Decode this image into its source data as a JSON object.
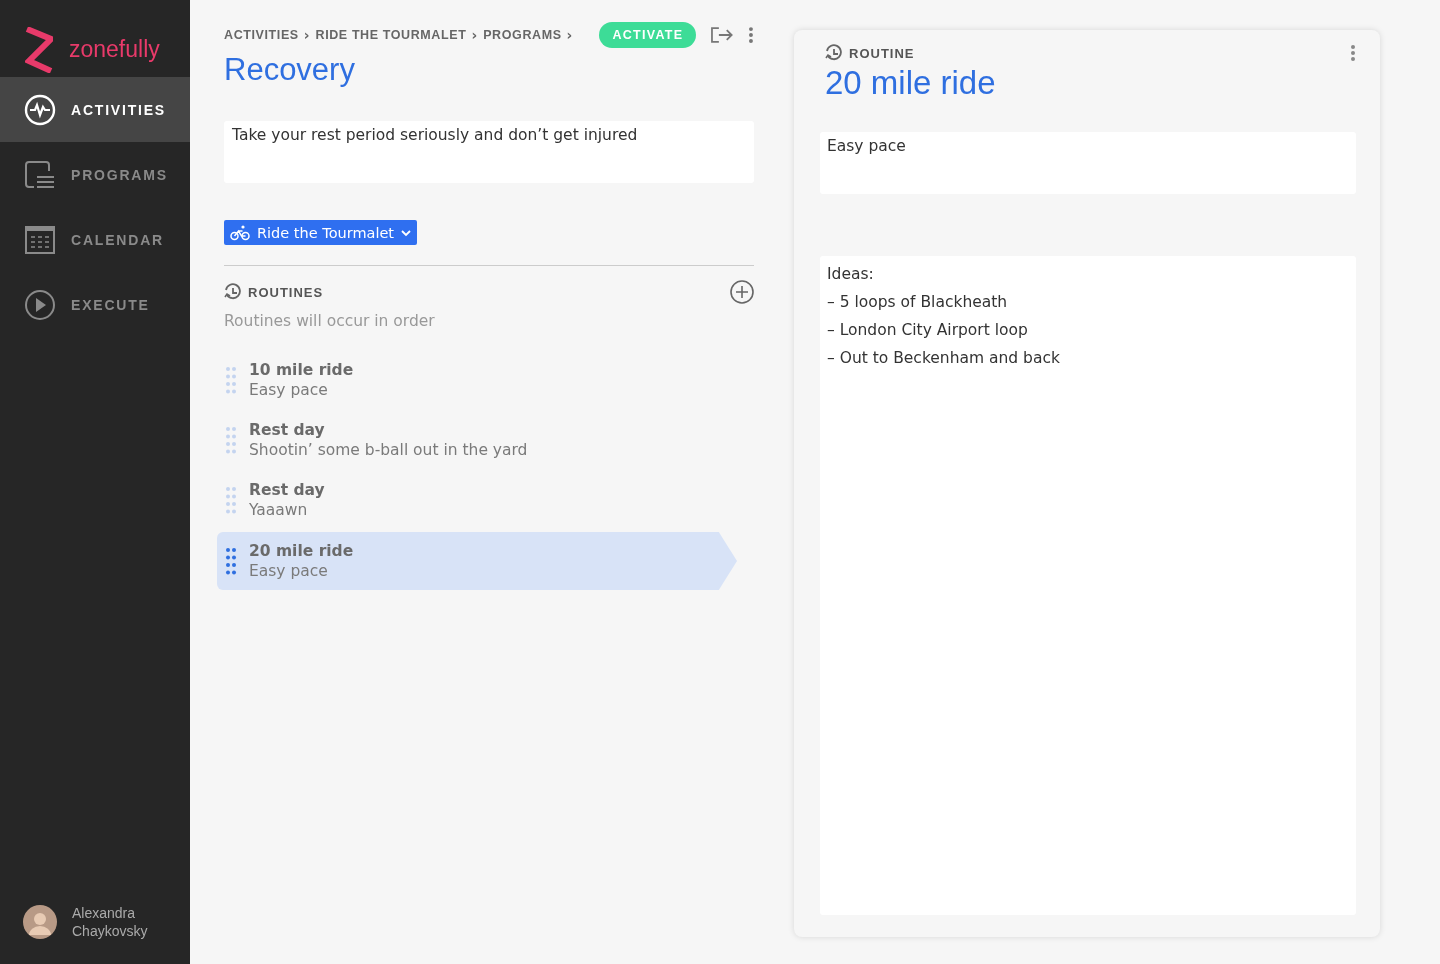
{
  "sidebar": {
    "logo": "zonefully",
    "items": [
      {
        "label": "ACTIVITIES",
        "kind": "pulse",
        "selected": true
      },
      {
        "label": "PROGRAMS",
        "kind": "programs",
        "selected": false
      },
      {
        "label": "CALENDAR",
        "kind": "calendar",
        "selected": false
      },
      {
        "label": "EXECUTE",
        "kind": "execute",
        "selected": false
      }
    ],
    "user": {
      "name": "Alexandra Chaykovsky"
    }
  },
  "breadcrumbs": [
    "ACTIVITIES",
    "RIDE THE TOURMALET",
    "PROGRAMS"
  ],
  "separator": "›",
  "activate_button": "ACTIVATE",
  "title": "Recovery",
  "description": "Take your rest period seriously and don’t get injured",
  "program_select": "Ride the Tourmalet",
  "routines": {
    "heading": "ROUTINES",
    "hint": "Routines will occur in order",
    "items": [
      {
        "title": "10 mile ride",
        "subtitle": "Easy pace",
        "selected": false
      },
      {
        "title": "Rest day",
        "subtitle": "Shootin’ some b-ball out in the yard",
        "selected": false
      },
      {
        "title": "Rest day",
        "subtitle": "Yaaawn",
        "selected": false
      },
      {
        "title": "20 mile ride",
        "subtitle": "Easy pace",
        "selected": true
      }
    ]
  },
  "routine_panel": {
    "label": "ROUTINE",
    "title": "20 mile ride",
    "description": "Easy pace",
    "notes": [
      "Ideas:",
      "– 5 loops of Blackheath",
      "– London City Airport loop",
      "– Out to Beckenham and back"
    ]
  }
}
